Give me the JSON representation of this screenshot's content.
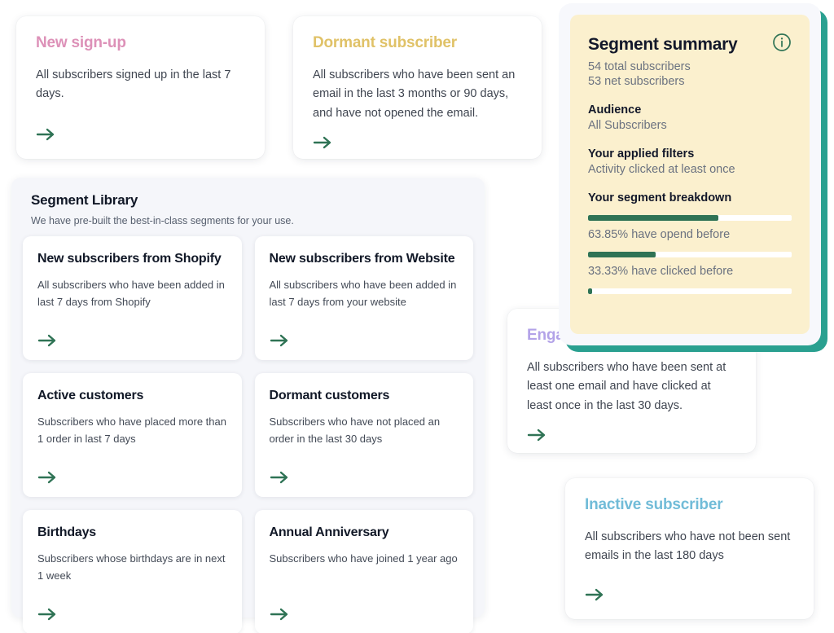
{
  "feature_cards": [
    {
      "id": "new-signup",
      "title": "New sign-up",
      "title_color": "#dd91b8",
      "description": "All subscribers signed up in the last 7 days.",
      "arrow_icon": "arrow-right-icon"
    },
    {
      "id": "dormant-subscriber",
      "title": "Dormant subscriber",
      "title_color": "#e0c268",
      "description": "All subscribers who have been sent an email in the last 3 months or 90 days, and have not opened the email.",
      "arrow_icon": "arrow-right-icon"
    },
    {
      "id": "engaged-subscriber",
      "title": "Engaged subscriber",
      "title_color": "#b3a3e8",
      "description": "All subscribers who have been sent at least one email and have clicked at least once in the last 30 days.",
      "arrow_icon": "arrow-right-icon"
    },
    {
      "id": "inactive-subscriber",
      "title": "Inactive subscriber",
      "title_color": "#72bcd8",
      "description": "All subscribers who have not been sent emails in the last 180 days",
      "arrow_icon": "arrow-right-icon"
    }
  ],
  "segment_library": {
    "title": "Segment Library",
    "subtitle": "We have pre-built the best-in-class segments for your use.",
    "cards": [
      {
        "title": "New subscribers from Shopify",
        "description": "All subscribers who have been added in last 7 days from Shopify",
        "arrow_icon": "arrow-right-icon"
      },
      {
        "title": "New subscribers from Website",
        "description": "All subscribers who have been added in last 7 days from your website",
        "arrow_icon": "arrow-right-icon"
      },
      {
        "title": "Active customers",
        "description": "Subscribers who have placed more than 1 order in last 7 days",
        "arrow_icon": "arrow-right-icon"
      },
      {
        "title": "Dormant customers",
        "description": "Subscribers who have not placed an order in the last 30 days",
        "arrow_icon": "arrow-right-icon"
      },
      {
        "title": "Birthdays",
        "description": "Subscribers whose birthdays are in next 1 week",
        "arrow_icon": "arrow-right-icon"
      },
      {
        "title": "Annual Anniversary",
        "description": "Subscribers who have joined 1 year ago",
        "arrow_icon": "arrow-right-icon"
      }
    ]
  },
  "segment_summary": {
    "title": "Segment summary",
    "info_icon": "info-circle-icon",
    "total_subscribers": "54 total subscribers",
    "net_subscribers": "53 net subscribers",
    "audience_label": "Audience",
    "audience_value": "All Subscribers",
    "filters_label": "Your applied filters",
    "filters_value": "Activity clicked at least once",
    "breakdown_label": "Your segment breakdown",
    "accent_color": "#2aa090",
    "bar_color": "#2f7355",
    "background_color": "#fbf0ce",
    "breakdown": [
      {
        "percent": 63.85,
        "caption": "63.85% have opend before"
      },
      {
        "percent": 33.33,
        "caption": "33.33% have clicked before"
      },
      {
        "percent": 2.0,
        "caption": ""
      }
    ]
  }
}
